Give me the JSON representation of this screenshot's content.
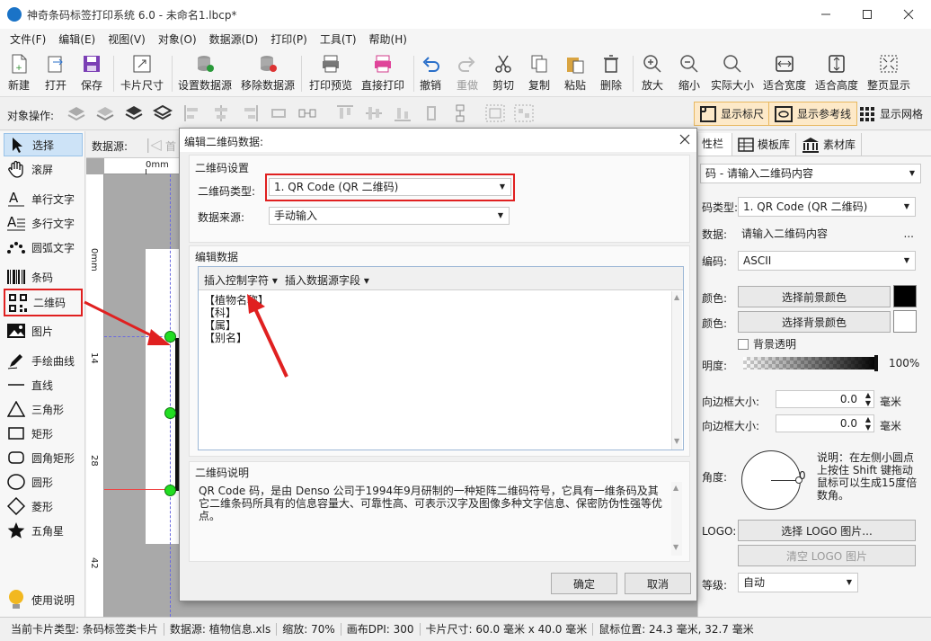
{
  "app": {
    "title": "神奇条码标签打印系统 6.0 - 未命名1.lbcp*"
  },
  "menu": [
    "文件(F)",
    "编辑(E)",
    "视图(V)",
    "对象(O)",
    "数据源(D)",
    "打印(P)",
    "工具(T)",
    "帮助(H)"
  ],
  "toolbar": {
    "new": "新建",
    "open": "打开",
    "save": "保存",
    "card_size": "卡片尺寸",
    "set_datasource": "设置数据源",
    "remove_datasource": "移除数据源",
    "print_preview": "打印预览",
    "direct_print": "直接打印",
    "undo": "撤销",
    "redo": "重做",
    "cut": "剪切",
    "copy": "复制",
    "paste": "粘贴",
    "delete": "删除",
    "zoom_in": "放大",
    "zoom_out": "缩小",
    "actual_size": "实际大小",
    "fit_width": "适合宽度",
    "fit_height": "适合高度",
    "fit_page": "整页显示"
  },
  "toolbar2": {
    "object_ops": "对象操作:",
    "show_ruler": "显示标尺",
    "show_guides": "显示参考线",
    "show_grid": "显示网格"
  },
  "tools": {
    "select": "选择",
    "pan": "滚屏",
    "single_text": "单行文字",
    "multi_text": "多行文字",
    "arc_text": "圆弧文字",
    "barcode": "条码",
    "qrcode": "二维码",
    "image": "图片",
    "freehand": "手绘曲线",
    "line": "直线",
    "triangle": "三角形",
    "rect": "矩形",
    "round_rect": "圆角矩形",
    "circle": "圆形",
    "diamond": "菱形",
    "star": "五角星",
    "help": "使用说明"
  },
  "canvas": {
    "datasource_label": "数据源:",
    "first_label": "首",
    "ruler_h0": "0mm",
    "ruler_v": [
      "0mm",
      "14",
      "28",
      "42"
    ]
  },
  "dialog": {
    "title": "编辑二维码数据:",
    "group_settings": "二维码设置",
    "type_label": "二维码类型:",
    "type_value": "1. QR Code (QR 二维码)",
    "source_label": "数据来源:",
    "source_value": "手动输入",
    "group_edit": "编辑数据",
    "insert_control": "插入控制字符",
    "insert_field": "插入数据源字段",
    "data_lines": [
      "【植物名称】",
      "【科】",
      "【属】",
      "【别名】"
    ],
    "group_desc": "二维码说明",
    "description": "QR Code 码，是由 Denso 公司于1994年9月研制的一种矩阵二维码符号，它具有一维条码及其它二维条码所具有的信息容量大、可靠性高、可表示汉字及图像多种文字信息、保密防伪性强等优点。",
    "ok": "确定",
    "cancel": "取消"
  },
  "panel": {
    "tabs": [
      "性栏",
      "模板库",
      "素材库"
    ],
    "content_value": "码 - 请输入二维码内容",
    "type_label": "码类型:",
    "type_value": "1. QR Code (QR 二维码)",
    "data_label": "数据:",
    "data_value": "请输入二维码内容",
    "data_more": "...",
    "encoding_label": "编码:",
    "encoding_value": "ASCII",
    "fg_label": "颜色:",
    "fg_button": "选择前景颜色",
    "bg_label": "颜色:",
    "bg_button": "选择背景颜色",
    "transparent": "背景透明",
    "opacity_label": "明度:",
    "opacity_value": "100%",
    "opacity": 1.0,
    "hmargin_label": "向边框大小:",
    "hmargin_value": "0.0",
    "vmargin_label": "向边框大小:",
    "vmargin_value": "0.0",
    "unit": "毫米",
    "angle_label": "角度:",
    "angle_value": "0",
    "angle_help": "说明：在左侧小圆点上按住 Shift 键拖动鼠标可以生成15度倍数角。",
    "logo_label": "LOGO:",
    "logo_select": "选择 LOGO 图片...",
    "logo_clear": "清空 LOGO 图片",
    "level_label": "等级:",
    "level_value": "自动"
  },
  "status": {
    "card_type": "当前卡片类型: 条码标签类卡片",
    "datasource": "数据源: 植物信息.xls",
    "zoom": "缩放: 70%",
    "dpi": "画布DPI: 300",
    "card_size": "卡片尺寸: 60.0 毫米 x 40.0 毫米",
    "mouse": "鼠标位置: 24.3 毫米, 32.7 毫米"
  },
  "colors": {
    "highlight": "#e02020",
    "accent": "#1a73c7",
    "handle": "#22dd22"
  }
}
